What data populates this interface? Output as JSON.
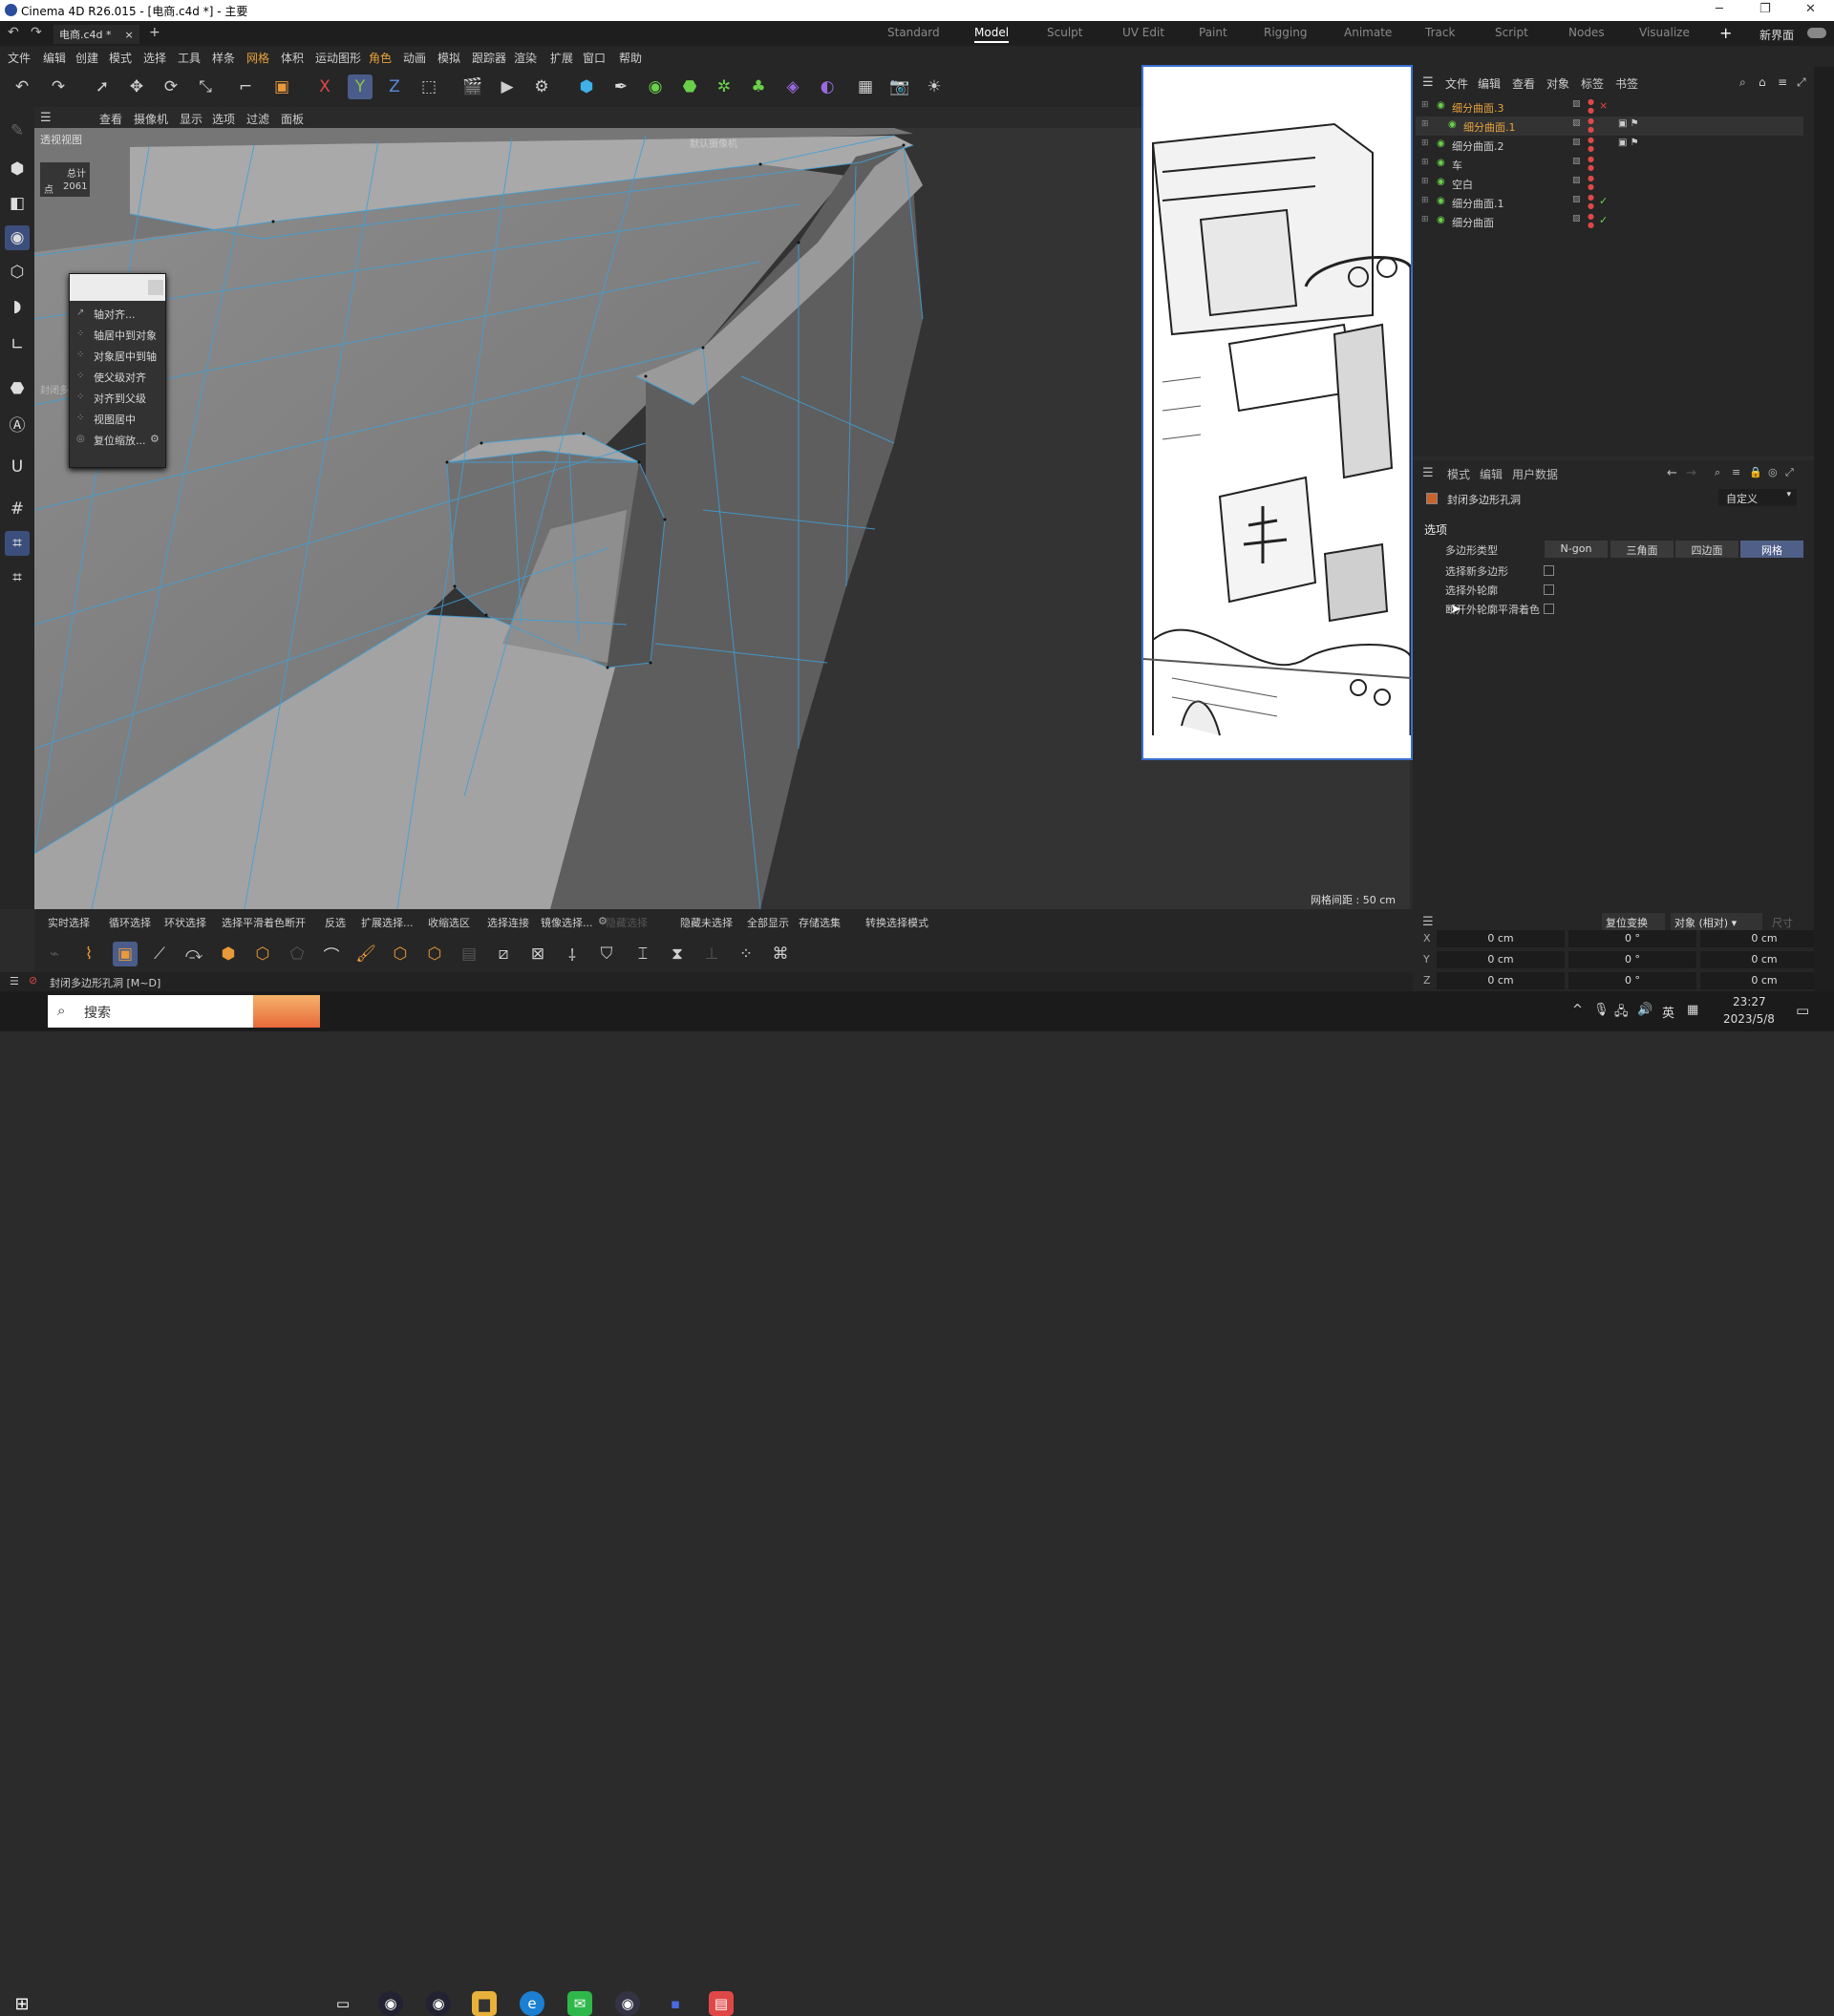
{
  "titlebar": {
    "title": "Cinema 4D R26.015 - [电商.c4d *] - 主要"
  },
  "tabs": {
    "file_tab": "电商.c4d *",
    "close": "×",
    "add": "+"
  },
  "workspaces": [
    "Standard",
    "Model",
    "Sculpt",
    "UV Edit",
    "Paint",
    "Rigging",
    "Animate",
    "Track",
    "Script",
    "Nodes",
    "Visualize"
  ],
  "workspace_active": "Model",
  "new_interface": "新界面",
  "menu": [
    "文件",
    "编辑",
    "创建",
    "模式",
    "选择",
    "工具",
    "样条",
    "网格",
    "体积",
    "运动图形",
    "角色",
    "动画",
    "模拟",
    "跟踪器",
    "渲染",
    "扩展",
    "窗口",
    "帮助"
  ],
  "viewport_menu": [
    "查看",
    "摄像机",
    "显示",
    "选项",
    "过滤",
    "面板"
  ],
  "viewport": {
    "label": "透视视图",
    "camera_label": "默认摄像机",
    "stats_title": "总计",
    "stats_points_label": "点",
    "stats_points_value": "2061",
    "side_label": "封闭多",
    "grid_spacing": "网格间距 : 50 cm"
  },
  "context_menu": [
    {
      "label": "轴对齐...",
      "icon": "↗"
    },
    {
      "label": "轴居中到对象",
      "icon": "⁘"
    },
    {
      "label": "对象居中到轴",
      "icon": "⁘"
    },
    {
      "label": "使父级对齐",
      "icon": "⁘"
    },
    {
      "label": "对齐到父级",
      "icon": "⁘"
    },
    {
      "label": "视图居中",
      "icon": "⁘"
    },
    {
      "label": "复位缩放...",
      "icon": "◎"
    }
  ],
  "object_manager": {
    "menu": [
      "文件",
      "编辑",
      "查看",
      "对象",
      "标签",
      "书签"
    ],
    "objects": [
      {
        "name": "细分曲面.3",
        "color": "#e8a33c",
        "indent": 0,
        "status": "×"
      },
      {
        "name": "细分曲面.1",
        "color": "#e8a33c",
        "indent": 1,
        "status": ""
      },
      {
        "name": "细分曲面.2",
        "color": "#cfcfcf",
        "indent": 0,
        "status": ""
      },
      {
        "name": "车",
        "color": "#cfcfcf",
        "indent": 0,
        "status": ""
      },
      {
        "name": "空白",
        "color": "#cfcfcf",
        "indent": 0,
        "status": ""
      },
      {
        "name": "细分曲面.1",
        "color": "#cfcfcf",
        "indent": 0,
        "status": "✓"
      },
      {
        "name": "细分曲面",
        "color": "#cfcfcf",
        "indent": 0,
        "status": "✓"
      }
    ]
  },
  "attributes": {
    "menu": [
      "模式",
      "编辑",
      "用户数据"
    ],
    "tool_name": "封闭多边形孔洞",
    "preset": "自定义",
    "section": "选项",
    "polygon_type_label": "多边形类型",
    "polygon_types": [
      "N-gon",
      "三角面",
      "四边面",
      "网格"
    ],
    "polygon_type_selected": "网格",
    "options": [
      {
        "label": "选择新多边形",
        "checked": false
      },
      {
        "label": "选择外轮廓",
        "checked": false
      },
      {
        "label": "断开外轮廓平滑着色",
        "checked": false
      }
    ]
  },
  "coords": {
    "reset_label": "复位变换",
    "mode": "对象 (相对)",
    "size_label": "尺寸",
    "rows": [
      {
        "axis": "X",
        "pos": "0 cm",
        "rot": "0 °",
        "size": "0 cm"
      },
      {
        "axis": "Y",
        "pos": "0 cm",
        "rot": "0 °",
        "size": "0 cm"
      },
      {
        "axis": "Z",
        "pos": "0 cm",
        "rot": "0 °",
        "size": "0 cm"
      }
    ]
  },
  "selection_bar": [
    "实时选择",
    "循环选择",
    "环状选择",
    "选择平滑着色断开",
    "反选",
    "扩展选择...",
    "收缩选区",
    "选择连接",
    "镜像选择...",
    "隐藏选择",
    "隐藏未选择",
    "全部显示",
    "存储选集",
    "转换选择模式"
  ],
  "status": {
    "text": "封闭多边形孔洞 [M~D]"
  },
  "taskbar": {
    "search": "搜索",
    "time": "23:27",
    "date": "2023/5/8",
    "ime": "英"
  },
  "colors": {
    "accent": "#3a6fd0",
    "mesh": "#3fa0d8",
    "bg": "#262626"
  }
}
